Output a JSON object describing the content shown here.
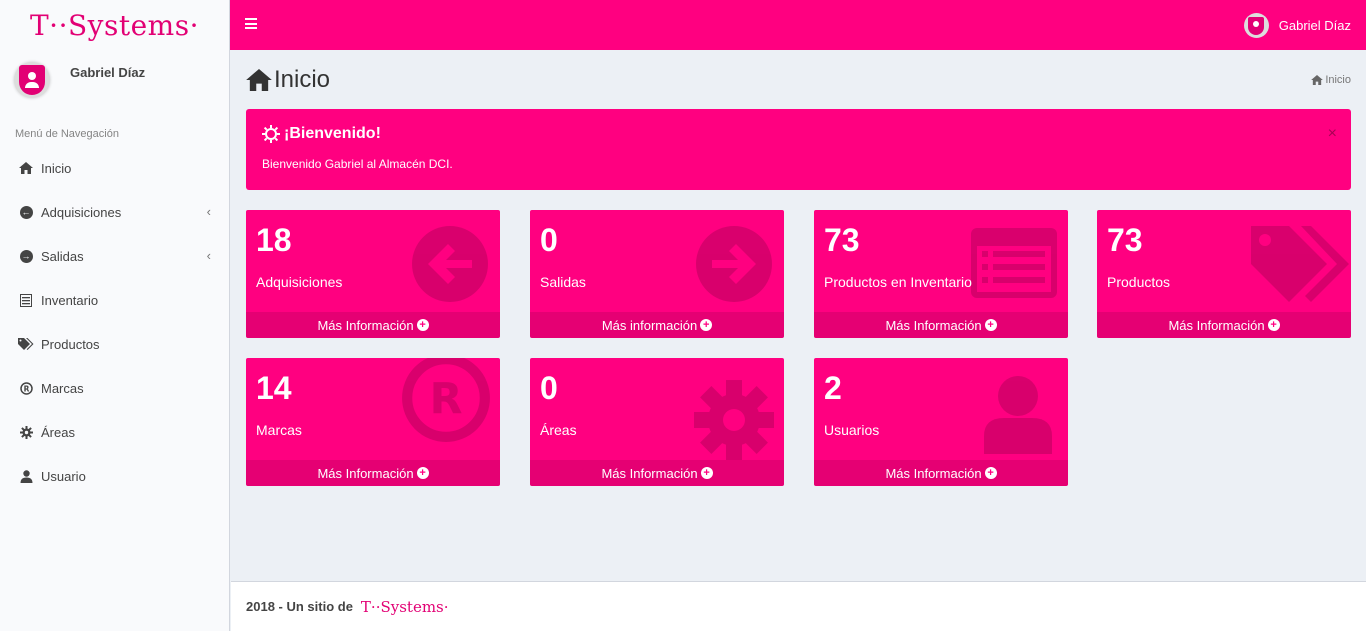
{
  "brand": {
    "logo_text": "T··Systems·",
    "color": "#e20074"
  },
  "user": {
    "name": "Gabriel Díaz"
  },
  "sidebar": {
    "header": "Menú de Navegación",
    "items": [
      {
        "label": "Inicio",
        "icon": "home-icon"
      },
      {
        "label": "Adquisiciones",
        "icon": "arrow-left-circle-icon",
        "chevron": "‹"
      },
      {
        "label": "Salidas",
        "icon": "arrow-right-circle-icon",
        "chevron": "‹"
      },
      {
        "label": "Inventario",
        "icon": "list-icon"
      },
      {
        "label": "Productos",
        "icon": "tags-icon"
      },
      {
        "label": "Marcas",
        "icon": "registered-icon"
      },
      {
        "label": "Áreas",
        "icon": "gear-icon"
      },
      {
        "label": "Usuario",
        "icon": "user-icon"
      }
    ]
  },
  "page": {
    "title": "Inicio",
    "breadcrumb": "Inicio"
  },
  "alert": {
    "title": "¡Bienvenido!",
    "text": "Bienvenido Gabriel al Almacén DCI.",
    "close": "×"
  },
  "boxes": [
    {
      "value": "18",
      "label": "Adquisiciones",
      "footer": "Más Información",
      "icon": "arrow-left-circle-icon"
    },
    {
      "value": "0",
      "label": "Salidas",
      "footer": "Más información",
      "icon": "arrow-right-circle-icon"
    },
    {
      "value": "73",
      "label": "Productos en Inventario",
      "footer": "Más Información",
      "icon": "list-icon"
    },
    {
      "value": "73",
      "label": "Productos",
      "footer": "Más Información",
      "icon": "tags-icon"
    },
    {
      "value": "14",
      "label": "Marcas",
      "footer": "Más Información",
      "icon": "registered-icon"
    },
    {
      "value": "0",
      "label": "Áreas",
      "footer": "Más Información",
      "icon": "gear-icon"
    },
    {
      "value": "2",
      "label": "Usuarios",
      "footer": "Más Información",
      "icon": "user-icon"
    }
  ],
  "footer": {
    "text": "2018 - Un sitio de",
    "logo_text": "T··Systems·"
  },
  "colors": {
    "primary": "#ff0080",
    "sidebar_bg": "#f9fafc",
    "content_bg": "#ecf0f5"
  }
}
